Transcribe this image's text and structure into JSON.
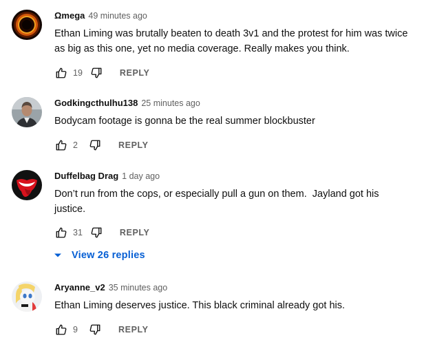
{
  "comments": [
    {
      "author": "Ωmega",
      "time": "49 minutes ago",
      "text": "Ethan Liming was brutally beaten to death 3v1 and the protest for him was twice as big as this one, yet no media coverage. Really makes you think.",
      "likes": "19",
      "reply_label": "REPLY",
      "avatar": "eye-of-sauron-avatar"
    },
    {
      "author": "Godkingcthulhu138",
      "time": "25 minutes ago",
      "text": "Bodycam footage is gonna be the real summer blockbuster",
      "likes": "2",
      "reply_label": "REPLY",
      "avatar": "man-portrait-avatar"
    },
    {
      "author": "Duffelbag Drag",
      "time": "1 day ago",
      "text": "Don’t run from the cops, or especially pull a gun on them.  Jayland got his justice.",
      "likes": "31",
      "reply_label": "REPLY",
      "avatar": "rolling-stones-tongue-avatar"
    },
    {
      "author": "Aryanne_v2",
      "time": "35 minutes ago",
      "text": "Ethan Liming deserves justice. This black criminal already got his.",
      "likes": "9",
      "reply_label": "REPLY",
      "avatar": "cartoon-pony-avatar"
    }
  ],
  "view_replies": {
    "label": "View 26 replies",
    "icon": "chevron-down-icon"
  },
  "colors": {
    "text": "#0f0f0f",
    "secondary": "#606060",
    "link": "#065fd4"
  }
}
